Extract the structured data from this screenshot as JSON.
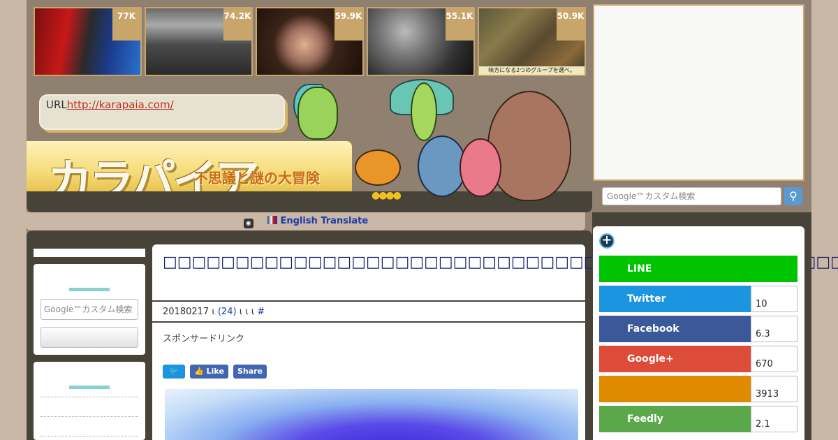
{
  "thumbnails": [
    {
      "count": "77K"
    },
    {
      "count": "74.2K"
    },
    {
      "count": "59.9K"
    },
    {
      "count": "55.1K"
    },
    {
      "count": "50.9K",
      "caption": "味方になる2つのグループを選べ。"
    }
  ],
  "header": {
    "url_label": "URL",
    "url": "http://karapaia.com/",
    "logo": "カラパイア",
    "tagline": "不思議と謎の大冒険"
  },
  "translate": {
    "separator": "ι",
    "label": "English Translate"
  },
  "sidebar": {
    "search_placeholder": "Google™カスタム検索"
  },
  "article": {
    "title": "□□□□□□□□□□□□□□□□□□□□□□□□□□□□□□□□□□□□□□□□□□□□□□□",
    "date": "20180217",
    "sep": "ι",
    "comments": "(24)",
    "tail": "ι ι ι",
    "hash": "#",
    "sponsor": "スポンサードリンク",
    "like_label": "Like",
    "share_label": "Share"
  },
  "right": {
    "search_placeholder": "Google™カスタム検索",
    "share": [
      {
        "label": "LINE",
        "color": "#00c300"
      },
      {
        "label": "Twitter",
        "count": "10",
        "color": "#1b95e0"
      },
      {
        "label": "Facebook",
        "count": "6.3",
        "color": "#3b5998"
      },
      {
        "label": "Google+",
        "count": "670",
        "color": "#dd4b39"
      },
      {
        "label": "",
        "count": "3913",
        "color": "#e08a00"
      },
      {
        "label": "Feedly",
        "count": "2.1",
        "color": "#5aa84a"
      }
    ]
  }
}
